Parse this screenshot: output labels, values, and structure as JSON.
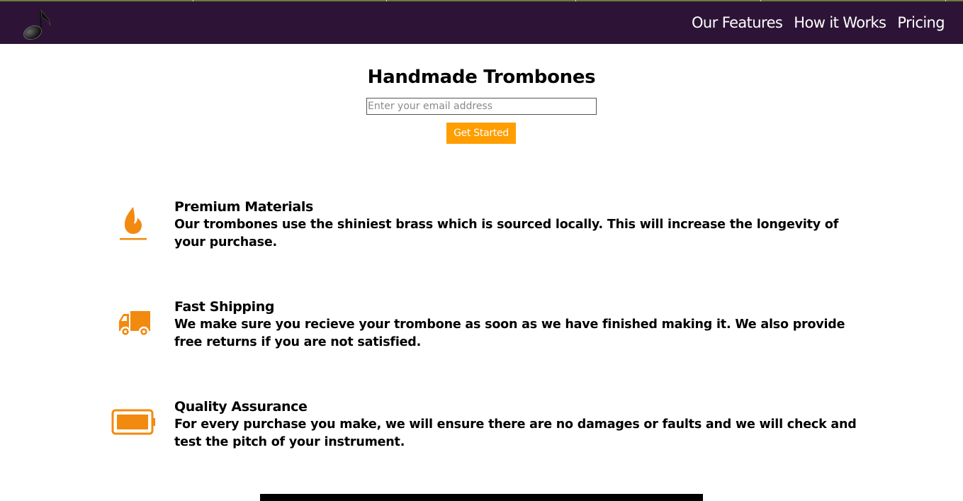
{
  "nav": {
    "links": [
      "Our Features",
      "How it Works",
      "Pricing"
    ]
  },
  "hero": {
    "title": "Handmade Trombones",
    "email_placeholder": "Enter your email address",
    "cta_label": "Get Started"
  },
  "features": [
    {
      "icon": "flame-icon",
      "title": "Premium Materials",
      "description": "Our trombones use the shiniest brass which is sourced locally. This will increase the longevity of your purchase."
    },
    {
      "icon": "truck-icon",
      "title": "Fast Shipping",
      "description": "We make sure you recieve your trombone as soon as we have finished making it. We also provide free returns if you are not satisfied."
    },
    {
      "icon": "battery-icon",
      "title": "Quality Assurance",
      "description": "For every purchase you make, we will ensure there are no damages or faults and we will check and test the pitch of your instrument."
    }
  ],
  "colors": {
    "navbar": "#2d1436",
    "accent": "#ff9e00",
    "icon": "#f28a0f"
  }
}
